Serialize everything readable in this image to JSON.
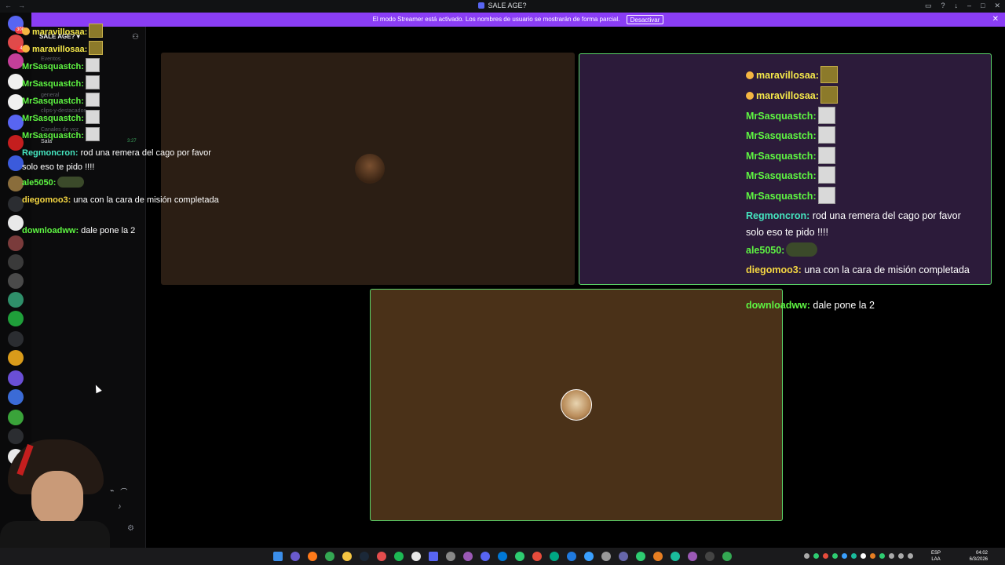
{
  "window": {
    "title": "SALE AGE?"
  },
  "banner": {
    "text": "El modo Streamer está activado. Los nombres de usuario se mostrarán de forma parcial.",
    "button": "Desactivar"
  },
  "sidebar": {
    "server_name": "SALE AGE? ▾",
    "channels": [
      "Eventos",
      "general",
      "clips-y-destacados",
      "Canales de voz",
      "Sala"
    ],
    "voice_time": "3:27"
  },
  "rail_badges": [
    "308",
    "4",
    "",
    "",
    "",
    "",
    "",
    "",
    "",
    "",
    "",
    "",
    "",
    "",
    "",
    "",
    "",
    "",
    "",
    "",
    "",
    "",
    "184"
  ],
  "chat": [
    {
      "user": "maravillosaa:",
      "color": "yellow",
      "text": "",
      "emote": "gold"
    },
    {
      "user": "maravillosaa:",
      "color": "yellow",
      "text": "",
      "emote": "gold"
    },
    {
      "user": "MrSasquastch:",
      "color": "green",
      "text": "",
      "emote": "white"
    },
    {
      "user": "MrSasquastch:",
      "color": "green",
      "text": "",
      "emote": "white"
    },
    {
      "user": "MrSasquastch:",
      "color": "green",
      "text": "",
      "emote": "white"
    },
    {
      "user": "MrSasquastch:",
      "color": "green",
      "text": "",
      "emote": "white"
    },
    {
      "user": "MrSasquastch:",
      "color": "green",
      "text": "",
      "emote": "white"
    },
    {
      "user": "Regmoncron:",
      "color": "cyan",
      "text": "rod una remera del cago por favor solo eso te pido !!!!",
      "emote": ""
    },
    {
      "user": "ale5050:",
      "color": "green",
      "text": "",
      "emote": "frog"
    },
    {
      "user": "diegomoo3:",
      "color": "gold",
      "text": "una con la cara de misión completada",
      "emote": ""
    },
    {
      "user": "downloadww:",
      "color": "green",
      "text": "dale pone la 2",
      "emote": ""
    }
  ],
  "colors": {
    "banner": "#8a3df5",
    "speaking_border": "#5bd66a",
    "tile_1": "#2b1e14",
    "tile_2": "#2c1b3a",
    "tile_3": "#4a3118"
  },
  "taskbar": {
    "lang": "ESP\nLAA",
    "time": "04:02",
    "date": "6/3/2026"
  }
}
